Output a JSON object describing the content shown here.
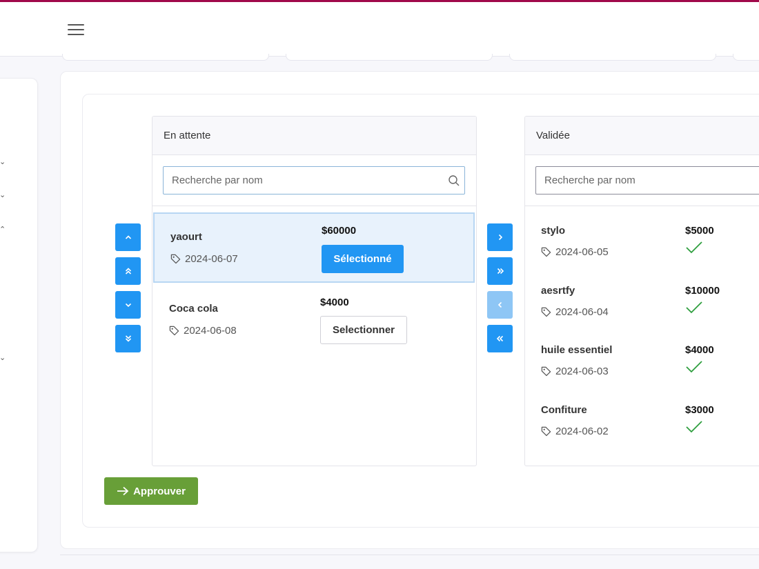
{
  "header": {
    "menu_icon": "hamburger-icon"
  },
  "pending_panel": {
    "title": "En attente",
    "search_placeholder": "Recherche par nom",
    "items": [
      {
        "name": "yaourt",
        "date": "2024-06-07",
        "price": "$60000",
        "button_label": "Sélectionné",
        "selected": true
      },
      {
        "name": "Coca cola",
        "date": "2024-06-08",
        "price": "$4000",
        "button_label": "Selectionner",
        "selected": false
      }
    ]
  },
  "validated_panel": {
    "title": "Validée",
    "search_placeholder": "Recherche par nom",
    "items": [
      {
        "name": "stylo",
        "date": "2024-06-05",
        "price": "$5000"
      },
      {
        "name": "aesrtfy",
        "date": "2024-06-04",
        "price": "$10000"
      },
      {
        "name": "huile essentiel",
        "date": "2024-06-03",
        "price": "$4000"
      },
      {
        "name": "Confiture",
        "date": "2024-06-02",
        "price": "$3000"
      }
    ]
  },
  "reorder_controls": [
    "chevron-up-icon",
    "double-chevron-up-icon",
    "chevron-down-icon",
    "double-chevron-down-icon"
  ],
  "transfer_controls": [
    "chevron-right-icon",
    "double-chevron-right-icon",
    "chevron-left-icon",
    "double-chevron-left-icon"
  ],
  "approve_button": {
    "label": "Approuver",
    "icon": "arrow-right-icon"
  },
  "colors": {
    "accent": "#2196f3",
    "approve": "#689f38",
    "check": "#2e9e3e",
    "top_line": "#a0094a"
  }
}
